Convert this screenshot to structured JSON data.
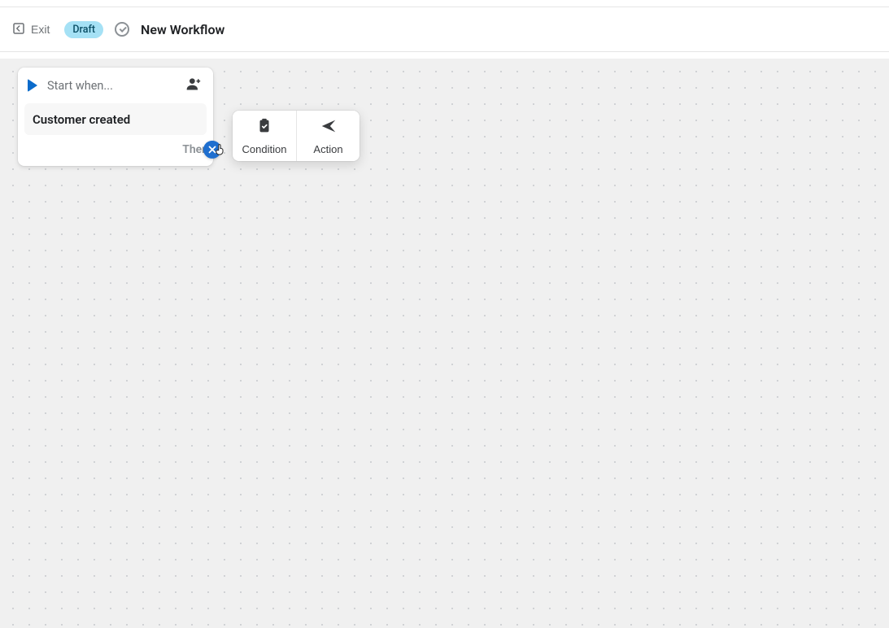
{
  "header": {
    "exit_label": "Exit",
    "badge": "Draft",
    "title": "New Workflow"
  },
  "trigger": {
    "header": "Start when...",
    "event": "Customer created",
    "then": "Then"
  },
  "popover": {
    "condition": "Condition",
    "action": "Action"
  }
}
